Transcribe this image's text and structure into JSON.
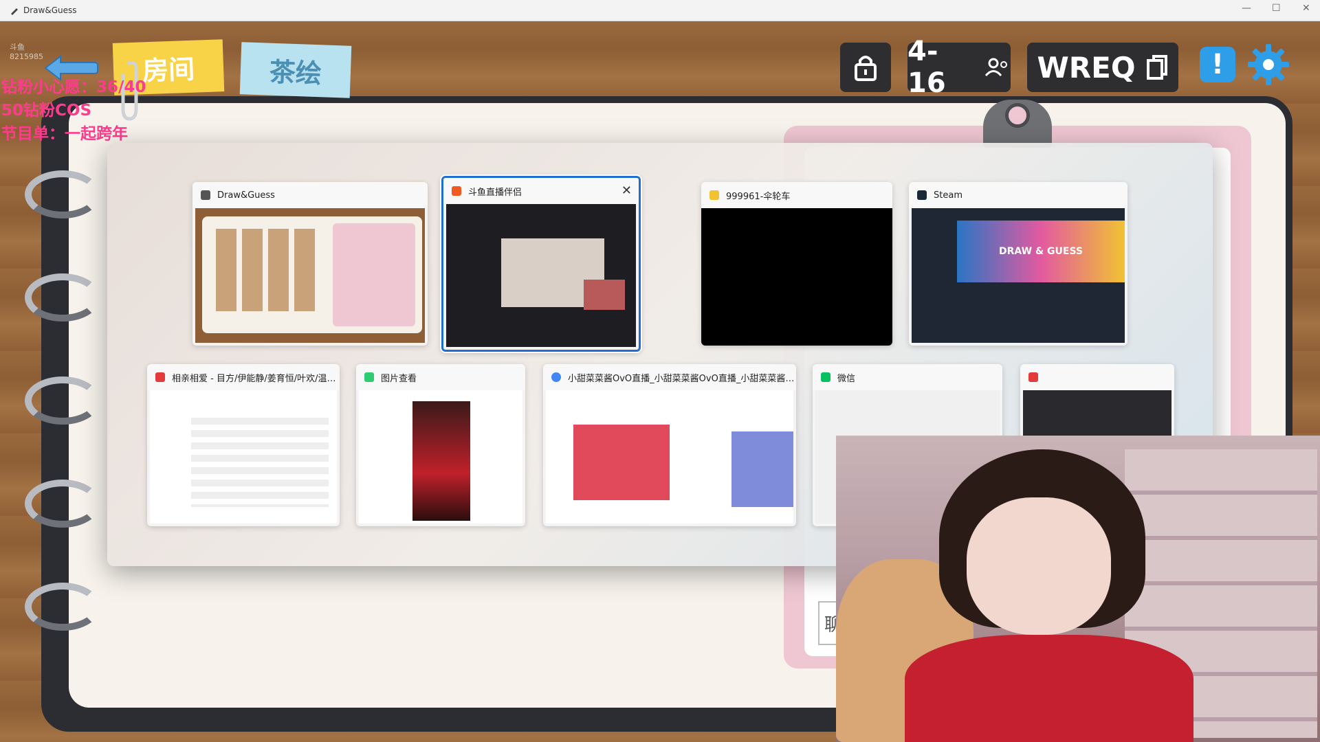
{
  "titlebar": {
    "app_title": "Draw&Guess",
    "minimize": "—",
    "maximize": "☐",
    "close": "✕"
  },
  "watermark": {
    "line1": "斗鱼",
    "line2": "8215985"
  },
  "overlay": {
    "line1": "钻粉小心愿：36/40",
    "line2": "50钻粉COS",
    "line3": "节目单：一起跨年"
  },
  "top_tabs": {
    "room": "房间",
    "tea": "茶绘"
  },
  "hud": {
    "players": "4-16",
    "room_code": "WREQ"
  },
  "alert_label": "!",
  "switcher": {
    "row1": [
      {
        "title": "Draw&Guess",
        "icon_color": "#555555"
      },
      {
        "title": "斗鱼直播伴侣",
        "icon_color": "#f25b1f"
      },
      {
        "title": "999961-伞轮车",
        "icon_color": "#f1c232"
      },
      {
        "title": "Steam",
        "icon_color": "#1b2838"
      }
    ],
    "row2": [
      {
        "title": "相亲相爱 - 目方/伊能静/姜育恒/叶欢/温兆...",
        "icon_color": "#e33b3b"
      },
      {
        "title": "图片查看",
        "icon_color": "#2ecc71"
      },
      {
        "title": "小甜菜菜酱OvO直播_小甜菜菜酱OvO直播_小甜菜菜酱OvO...",
        "icon_color": "#4285f4"
      },
      {
        "title": "微信",
        "icon_color": "#07c160"
      },
      {
        "title": "",
        "icon_color": "#e33b3b"
      }
    ],
    "close_icon": "✕",
    "steam_banner": "DRAW & GUESS"
  },
  "clipboard": {
    "side_char": "聊"
  },
  "colors": {
    "accent_blue": "#1f6fd1",
    "overlay_pink": "#ff3b8d",
    "sticky_yellow": "#f8d247",
    "sticky_blue": "#b9e2f0"
  }
}
